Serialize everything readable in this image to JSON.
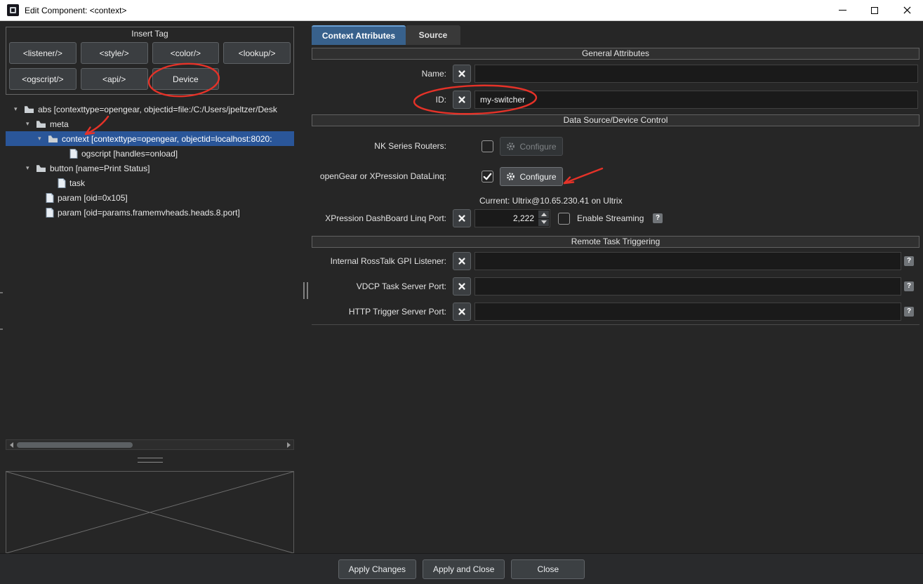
{
  "window": {
    "title": "Edit Component: <context>"
  },
  "insert_tag": {
    "title": "Insert Tag",
    "buttons": [
      "<listener/>",
      "<style/>",
      "<color/>",
      "<lookup/>",
      "<ogscript/>",
      "<api/>",
      "Device"
    ]
  },
  "tree": {
    "items": [
      {
        "label": "abs [contexttype=opengear, objectid=file:/C:/Users/jpeltzer/Desk"
      },
      {
        "label": "meta"
      },
      {
        "label": "context [contexttype=opengear, objectid=localhost:8020:"
      },
      {
        "label": "ogscript [handles=onload]"
      },
      {
        "label": "button [name=Print Status]"
      },
      {
        "label": "task"
      },
      {
        "label": "param [oid=0x105]"
      },
      {
        "label": "param [oid=params.framemvheads.heads.8.port]"
      }
    ]
  },
  "tabs": {
    "context_attributes": "Context Attributes",
    "source": "Source"
  },
  "general": {
    "header": "General Attributes",
    "name_label": "Name:",
    "name_value": "",
    "id_label": "ID:",
    "id_value": "my-switcher"
  },
  "device_control": {
    "header": "Data Source/Device Control",
    "nk_label": "NK Series Routers:",
    "datalinq_label": "openGear or XPression DataLinq:",
    "configure_label": "Configure",
    "current_text": "Current: Ultrix@10.65.230.41 on Ultrix",
    "port_label": "XPression DashBoard Linq Port:",
    "port_value": "2,222",
    "enable_streaming_label": "Enable Streaming",
    "help_glyph": "?"
  },
  "remote_task": {
    "header": "Remote Task Triggering",
    "gpi_label": "Internal RossTalk GPI Listener:",
    "vdcp_label": "VDCP Task Server Port:",
    "http_label": "HTTP Trigger Server Port:"
  },
  "footer": {
    "apply_changes": "Apply Changes",
    "apply_and_close": "Apply and Close",
    "close": "Close"
  },
  "colors": {
    "selection_blue": "#2a5699",
    "tab_blue": "#38618c",
    "annotation_red": "#e53228"
  },
  "icons": {
    "clear": "bold white X glyph",
    "configure": "gear glyph",
    "help": "question-mark badge",
    "tree_folder": "folder glyph",
    "tree_file": "document glyph",
    "expand": "down triangle"
  }
}
